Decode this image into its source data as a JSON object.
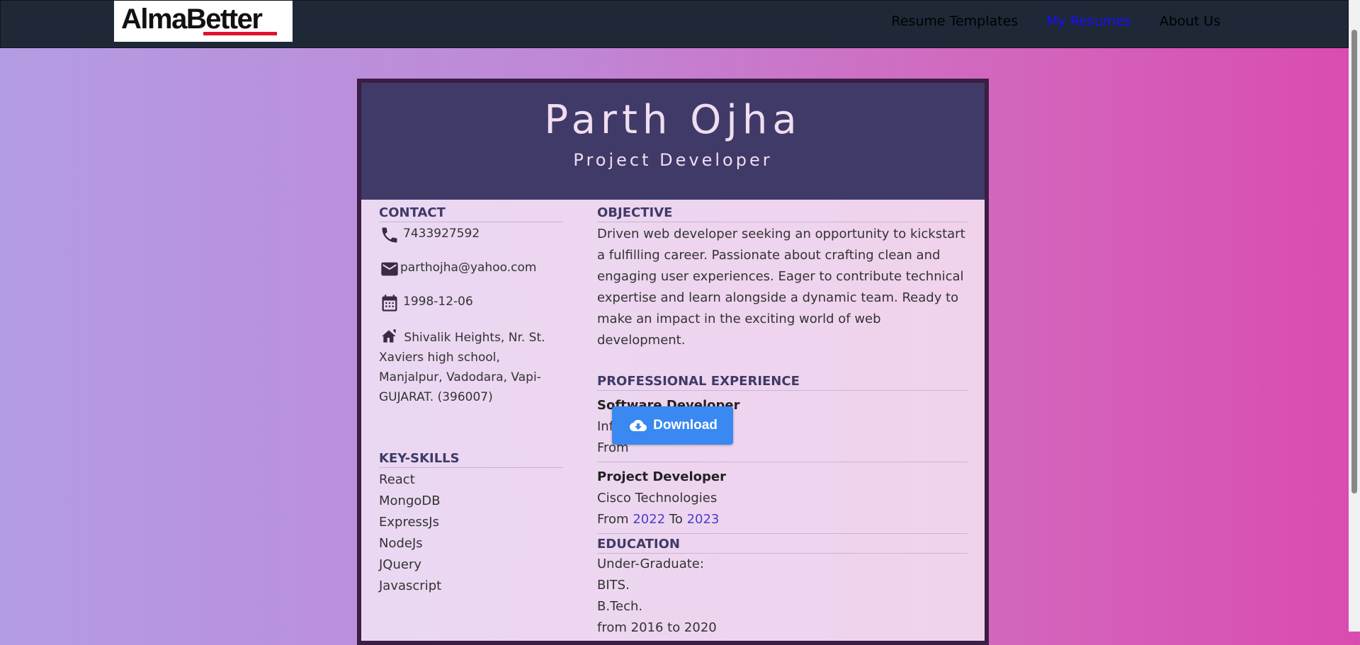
{
  "navbar": {
    "logo_text": "AlmaBetter",
    "links": [
      "Resume Templates",
      "My Resumes",
      "About Us"
    ]
  },
  "resume": {
    "name": "Parth Ojha",
    "title": "Project Developer",
    "contact": {
      "heading": "CONTACT",
      "phone": "7433927592",
      "email": "parthojha@yahoo.com",
      "dob": "1998-12-06",
      "address": "Shivalik Heights, Nr. St. Xaviers high school, Manjalpur, Vadodara, Vapi-GUJARAT. (396007)"
    },
    "skills": {
      "heading": "KEY-SKILLS",
      "items": [
        "React",
        "MongoDB",
        "ExpressJs",
        "NodeJs",
        "JQuery",
        "Javascript"
      ]
    },
    "objective": {
      "heading": "OBJECTIVE",
      "text": "Driven web developer seeking an opportunity to kickstart a fulfilling career. Passionate about crafting clean and engaging user experiences. Eager to contribute technical expertise and learn alongside a dynamic team. Ready to make an impact in the exciting world of web development."
    },
    "experience": {
      "heading": "PROFESSIONAL EXPERIENCE",
      "jobs": [
        {
          "title": "Software Developer",
          "company": "Infotech Solutions",
          "from_label": "From",
          "from": "",
          "to_label": "",
          "to": ""
        },
        {
          "title": "Project Developer",
          "company": "Cisco Technologies",
          "from_label": "From",
          "from": "2022",
          "to_label": "To",
          "to": "2023"
        }
      ]
    },
    "education": {
      "heading": "EDUCATION",
      "level": "Under-Graduate:",
      "institute": "BITS.",
      "degree": "B.Tech.",
      "period": "from 2016 to 2020"
    }
  },
  "download": {
    "label": "Download"
  },
  "colors": {
    "navbar": "#1e2837",
    "header": "#3f3a67",
    "accent_link": "#1a0dff",
    "download": "#3a88f2",
    "year_link": "#4b3ccf"
  }
}
